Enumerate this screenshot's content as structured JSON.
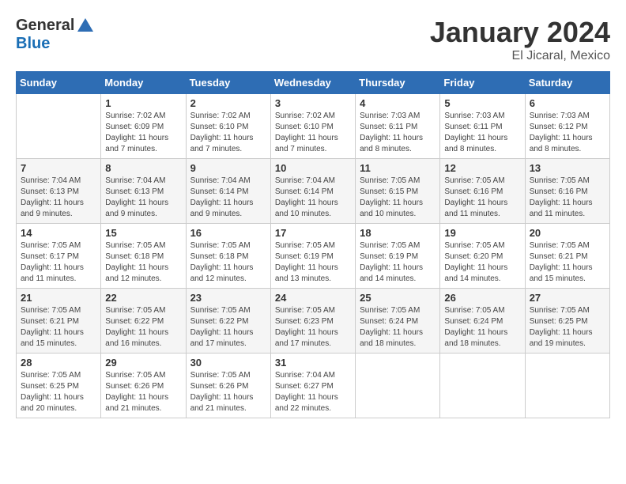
{
  "logo": {
    "general": "General",
    "blue": "Blue"
  },
  "header": {
    "month": "January 2024",
    "location": "El Jicaral, Mexico"
  },
  "days_of_week": [
    "Sunday",
    "Monday",
    "Tuesday",
    "Wednesday",
    "Thursday",
    "Friday",
    "Saturday"
  ],
  "weeks": [
    [
      {
        "day": "",
        "info": ""
      },
      {
        "day": "1",
        "info": "Sunrise: 7:02 AM\nSunset: 6:09 PM\nDaylight: 11 hours\nand 7 minutes."
      },
      {
        "day": "2",
        "info": "Sunrise: 7:02 AM\nSunset: 6:10 PM\nDaylight: 11 hours\nand 7 minutes."
      },
      {
        "day": "3",
        "info": "Sunrise: 7:02 AM\nSunset: 6:10 PM\nDaylight: 11 hours\nand 7 minutes."
      },
      {
        "day": "4",
        "info": "Sunrise: 7:03 AM\nSunset: 6:11 PM\nDaylight: 11 hours\nand 8 minutes."
      },
      {
        "day": "5",
        "info": "Sunrise: 7:03 AM\nSunset: 6:11 PM\nDaylight: 11 hours\nand 8 minutes."
      },
      {
        "day": "6",
        "info": "Sunrise: 7:03 AM\nSunset: 6:12 PM\nDaylight: 11 hours\nand 8 minutes."
      }
    ],
    [
      {
        "day": "7",
        "info": "Sunrise: 7:04 AM\nSunset: 6:13 PM\nDaylight: 11 hours\nand 9 minutes."
      },
      {
        "day": "8",
        "info": "Sunrise: 7:04 AM\nSunset: 6:13 PM\nDaylight: 11 hours\nand 9 minutes."
      },
      {
        "day": "9",
        "info": "Sunrise: 7:04 AM\nSunset: 6:14 PM\nDaylight: 11 hours\nand 9 minutes."
      },
      {
        "day": "10",
        "info": "Sunrise: 7:04 AM\nSunset: 6:14 PM\nDaylight: 11 hours\nand 10 minutes."
      },
      {
        "day": "11",
        "info": "Sunrise: 7:05 AM\nSunset: 6:15 PM\nDaylight: 11 hours\nand 10 minutes."
      },
      {
        "day": "12",
        "info": "Sunrise: 7:05 AM\nSunset: 6:16 PM\nDaylight: 11 hours\nand 11 minutes."
      },
      {
        "day": "13",
        "info": "Sunrise: 7:05 AM\nSunset: 6:16 PM\nDaylight: 11 hours\nand 11 minutes."
      }
    ],
    [
      {
        "day": "14",
        "info": "Sunrise: 7:05 AM\nSunset: 6:17 PM\nDaylight: 11 hours\nand 11 minutes."
      },
      {
        "day": "15",
        "info": "Sunrise: 7:05 AM\nSunset: 6:18 PM\nDaylight: 11 hours\nand 12 minutes."
      },
      {
        "day": "16",
        "info": "Sunrise: 7:05 AM\nSunset: 6:18 PM\nDaylight: 11 hours\nand 12 minutes."
      },
      {
        "day": "17",
        "info": "Sunrise: 7:05 AM\nSunset: 6:19 PM\nDaylight: 11 hours\nand 13 minutes."
      },
      {
        "day": "18",
        "info": "Sunrise: 7:05 AM\nSunset: 6:19 PM\nDaylight: 11 hours\nand 14 minutes."
      },
      {
        "day": "19",
        "info": "Sunrise: 7:05 AM\nSunset: 6:20 PM\nDaylight: 11 hours\nand 14 minutes."
      },
      {
        "day": "20",
        "info": "Sunrise: 7:05 AM\nSunset: 6:21 PM\nDaylight: 11 hours\nand 15 minutes."
      }
    ],
    [
      {
        "day": "21",
        "info": "Sunrise: 7:05 AM\nSunset: 6:21 PM\nDaylight: 11 hours\nand 15 minutes."
      },
      {
        "day": "22",
        "info": "Sunrise: 7:05 AM\nSunset: 6:22 PM\nDaylight: 11 hours\nand 16 minutes."
      },
      {
        "day": "23",
        "info": "Sunrise: 7:05 AM\nSunset: 6:22 PM\nDaylight: 11 hours\nand 17 minutes."
      },
      {
        "day": "24",
        "info": "Sunrise: 7:05 AM\nSunset: 6:23 PM\nDaylight: 11 hours\nand 17 minutes."
      },
      {
        "day": "25",
        "info": "Sunrise: 7:05 AM\nSunset: 6:24 PM\nDaylight: 11 hours\nand 18 minutes."
      },
      {
        "day": "26",
        "info": "Sunrise: 7:05 AM\nSunset: 6:24 PM\nDaylight: 11 hours\nand 18 minutes."
      },
      {
        "day": "27",
        "info": "Sunrise: 7:05 AM\nSunset: 6:25 PM\nDaylight: 11 hours\nand 19 minutes."
      }
    ],
    [
      {
        "day": "28",
        "info": "Sunrise: 7:05 AM\nSunset: 6:25 PM\nDaylight: 11 hours\nand 20 minutes."
      },
      {
        "day": "29",
        "info": "Sunrise: 7:05 AM\nSunset: 6:26 PM\nDaylight: 11 hours\nand 21 minutes."
      },
      {
        "day": "30",
        "info": "Sunrise: 7:05 AM\nSunset: 6:26 PM\nDaylight: 11 hours\nand 21 minutes."
      },
      {
        "day": "31",
        "info": "Sunrise: 7:04 AM\nSunset: 6:27 PM\nDaylight: 11 hours\nand 22 minutes."
      },
      {
        "day": "",
        "info": ""
      },
      {
        "day": "",
        "info": ""
      },
      {
        "day": "",
        "info": ""
      }
    ]
  ]
}
